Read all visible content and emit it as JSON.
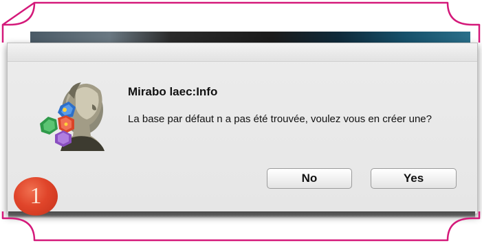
{
  "dialog": {
    "title": "Mirabo laec:Info",
    "message": "La base par défaut n a pas été trouvée, voulez vous en créer une?",
    "no_label": "No",
    "yes_label": "Yes",
    "app_icon": "mirabo-portrait-gems-icon"
  },
  "annotation": {
    "step_number": "1",
    "frame_color": "#d4197a",
    "badge_color": "#e0452a"
  }
}
